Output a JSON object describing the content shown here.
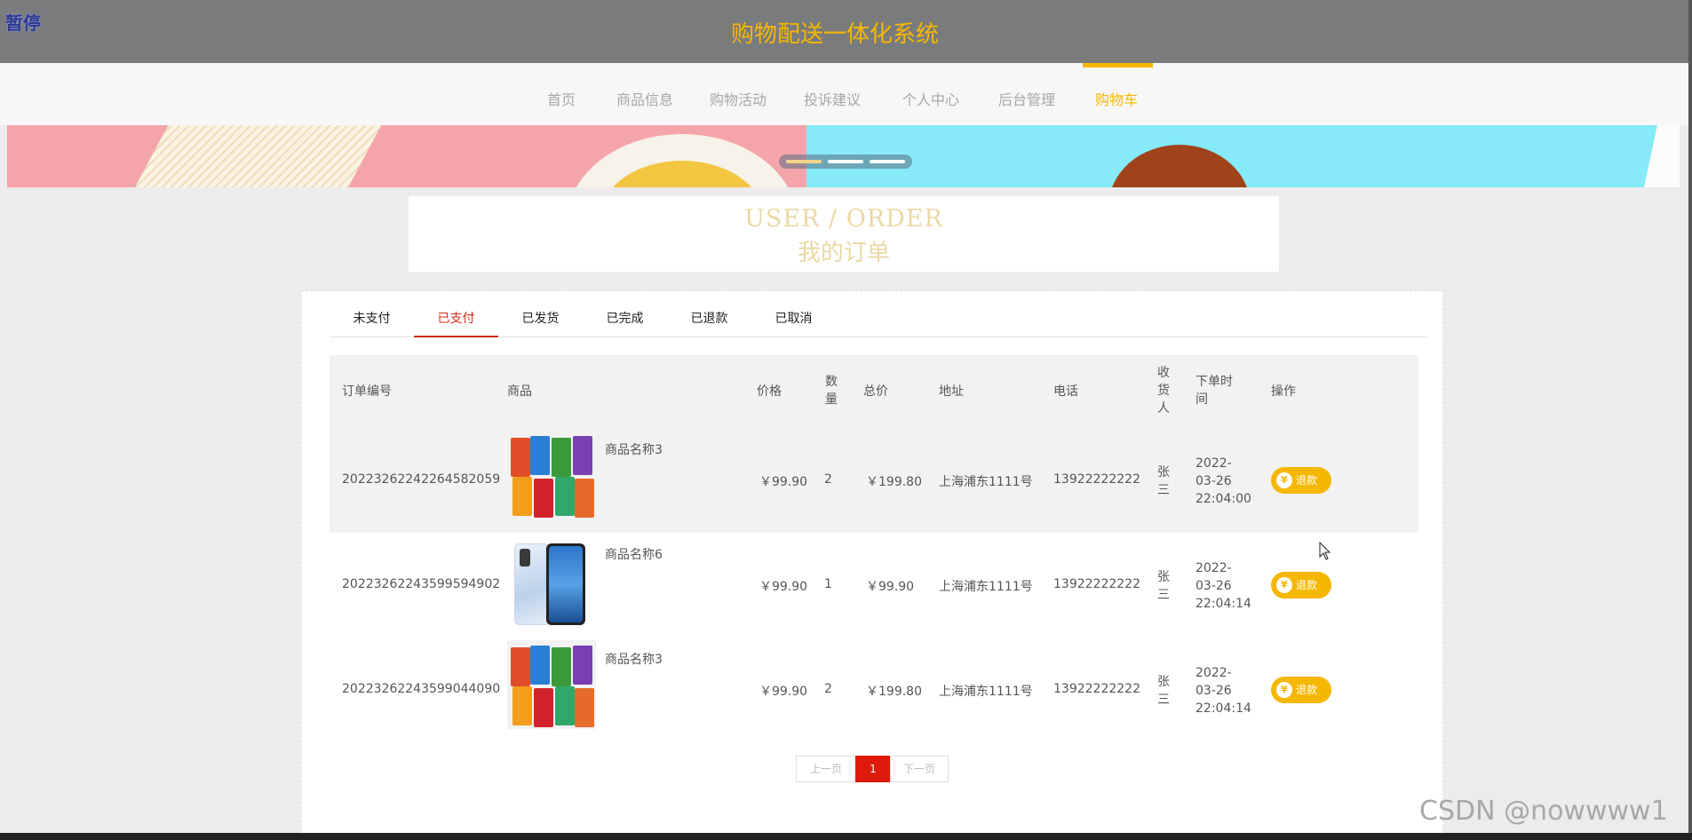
{
  "overlay": {
    "pause_label": "暂停",
    "watermark": "CSDN @nowwww1"
  },
  "header": {
    "title": "购物配送一体化系统"
  },
  "nav": {
    "items": [
      {
        "label": "首页"
      },
      {
        "label": "商品信息"
      },
      {
        "label": "购物活动"
      },
      {
        "label": "投诉建议"
      },
      {
        "label": "个人中心"
      },
      {
        "label": "后台管理"
      },
      {
        "label": "购物车"
      }
    ],
    "active_index": 6
  },
  "colors": {
    "accent": "#f5b800",
    "tab_active": "#d32c1c",
    "pager_current": "#dd1a0b",
    "topbar": "#7a7b7d"
  },
  "carousel": {
    "slide_count": 3,
    "active_slide": 1
  },
  "section": {
    "title_en": "USER / ORDER",
    "title_zh": "我的订单"
  },
  "tabs": [
    {
      "label": "未支付"
    },
    {
      "label": "已支付"
    },
    {
      "label": "已发货"
    },
    {
      "label": "已完成"
    },
    {
      "label": "已退款"
    },
    {
      "label": "已取消"
    }
  ],
  "active_tab": 1,
  "table": {
    "headers": {
      "order_no": "订单编号",
      "product": "商品",
      "price": "价格",
      "qty": "数量",
      "total": "总价",
      "address": "地址",
      "phone": "电话",
      "receiver": "收货人",
      "time": "下单时间",
      "action": "操作"
    },
    "rows": [
      {
        "order_no": "20223262242264582059",
        "product_name": "商品名称3",
        "product_image": "snack-pack-image",
        "price": "￥99.90",
        "qty": "2",
        "total": "￥199.80",
        "address": "上海浦东1111号",
        "phone": "13922222222",
        "receiver": "张三",
        "time": "2022-03-26 22:04:00",
        "action": "退款"
      },
      {
        "order_no": "20223262243599594902",
        "product_name": "商品名称6",
        "product_image": "smartphone-image",
        "price": "￥99.90",
        "qty": "1",
        "total": "￥99.90",
        "address": "上海浦东1111号",
        "phone": "13922222222",
        "receiver": "张三",
        "time": "2022-03-26 22:04:14",
        "action": "退款"
      },
      {
        "order_no": "20223262243599044090",
        "product_name": "商品名称3",
        "product_image": "snack-pack-image",
        "price": "￥99.90",
        "qty": "2",
        "total": "￥199.80",
        "address": "上海浦东1111号",
        "phone": "13922222222",
        "receiver": "张三",
        "time": "2022-03-26 22:04:14",
        "action": "退款"
      }
    ],
    "refund_icon": "yen-icon"
  },
  "pagination": {
    "prev": "上一页",
    "current": "1",
    "next": "下一页"
  }
}
